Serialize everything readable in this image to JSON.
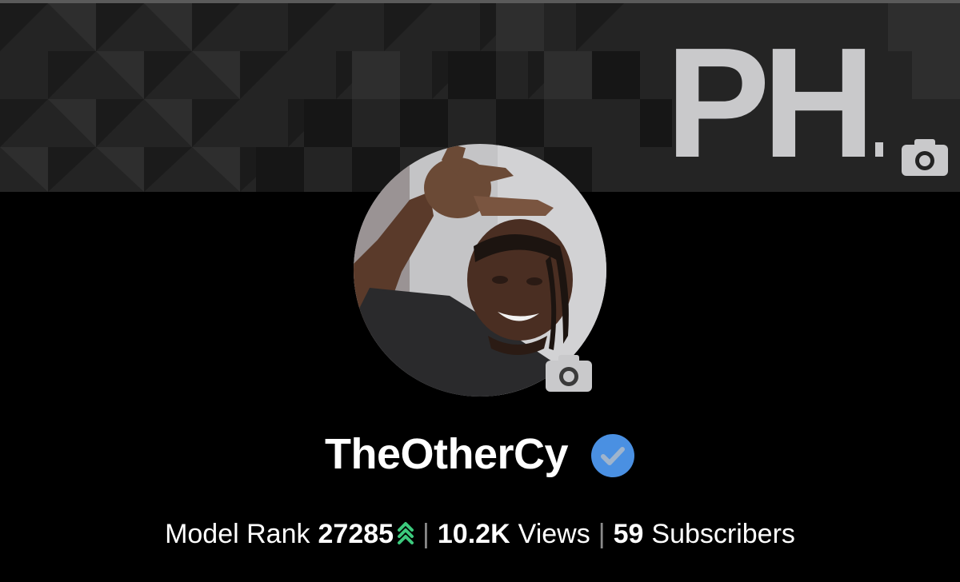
{
  "cover": {
    "logo_text": "PH",
    "camera_icon": "camera-icon",
    "background_color": "#232323",
    "logo_color": "#c9c9cb"
  },
  "profile": {
    "avatar_icon": "profile-photo",
    "camera_icon": "camera-icon",
    "username": "TheOtherCy",
    "verified_icon": "verified-check-icon",
    "verified_color": "#4a90e2"
  },
  "stats": {
    "rank_label": "Model Rank",
    "rank_value": "27285",
    "rank_trend_icon": "rank-up-arrows-icon",
    "rank_trend_color": "#3cc97d",
    "separator": "|",
    "views_value": "10.2K",
    "views_label": "Views",
    "subscribers_value": "59",
    "subscribers_label": "Subscribers"
  }
}
